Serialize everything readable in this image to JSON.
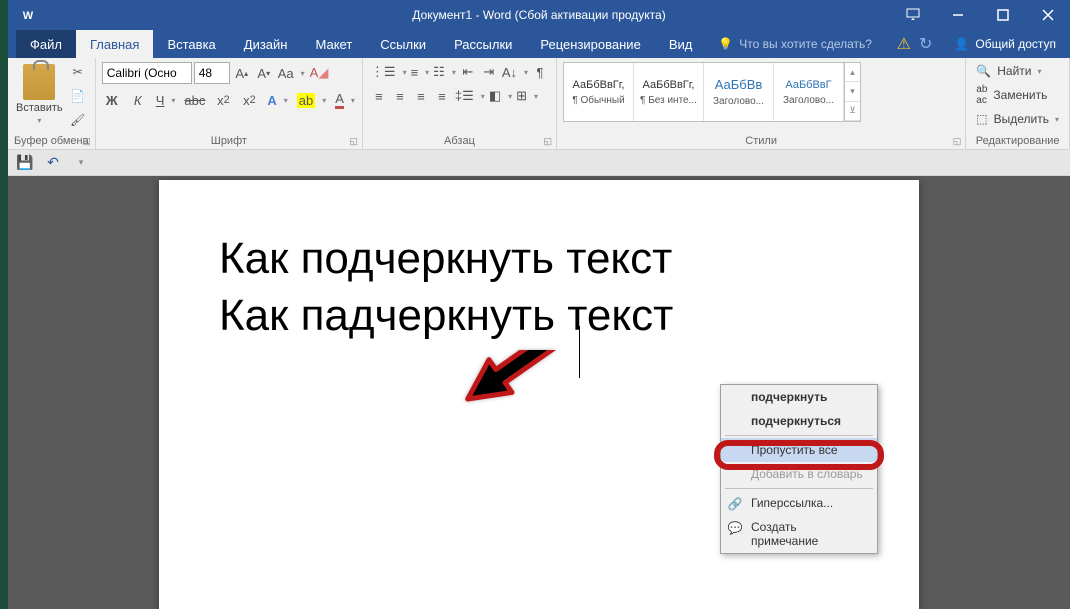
{
  "titlebar": {
    "title": "Документ1 - Word (Сбой активации продукта)"
  },
  "tabs": {
    "file": "Файл",
    "home": "Главная",
    "insert": "Вставка",
    "design": "Дизайн",
    "layout": "Макет",
    "references": "Ссылки",
    "mailings": "Рассылки",
    "review": "Рецензирование",
    "view": "Вид",
    "tell_me": "Что вы хотите сделать?",
    "share": "Общий доступ"
  },
  "ribbon": {
    "clipboard": {
      "label": "Буфер обмена",
      "paste": "Вставить"
    },
    "font": {
      "label": "Шрифт",
      "name": "Calibri (Осно",
      "size": "48"
    },
    "paragraph": {
      "label": "Абзац"
    },
    "styles": {
      "label": "Стили",
      "items": [
        {
          "preview": "АаБбВвГг,",
          "name": "¶ Обычный"
        },
        {
          "preview": "АаБбВвГг,",
          "name": "¶ Без инте..."
        },
        {
          "preview": "АаБбВв",
          "name": "Заголово..."
        },
        {
          "preview": "АаБбВвГ",
          "name": "Заголово..."
        }
      ]
    },
    "editing": {
      "label": "Редактирование",
      "find": "Найти",
      "replace": "Заменить",
      "select": "Выделить"
    }
  },
  "document": {
    "line1": "Как подчеркнуть текст",
    "line2_before": "Как ",
    "line2_misspelled": "падчеркнуть",
    "line2_after": " текст"
  },
  "context_menu": {
    "suggestion1": "подчеркнуть",
    "suggestion2": "подчеркнуться",
    "ignore_all": "Пропустить все",
    "add_to_dict": "Добавить в словарь",
    "hyperlink": "Гиперссылка...",
    "new_comment": "Создать примечание"
  }
}
